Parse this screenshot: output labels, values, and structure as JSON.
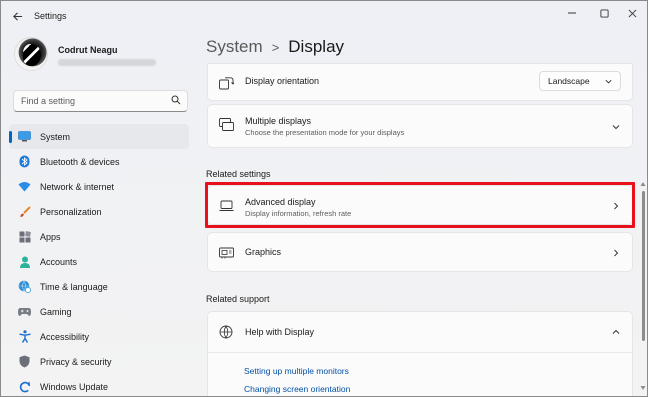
{
  "window": {
    "title": "Settings",
    "back_icon": "back-arrow-icon",
    "controls": [
      "minimize-icon",
      "maximize-icon",
      "close-icon"
    ]
  },
  "profile": {
    "name": "Codrut Neagu"
  },
  "search": {
    "placeholder": "Find a setting"
  },
  "sidebar": {
    "items": [
      {
        "label": "System",
        "icon": "system-icon",
        "active": true
      },
      {
        "label": "Bluetooth & devices",
        "icon": "bluetooth-icon"
      },
      {
        "label": "Network & internet",
        "icon": "wifi-icon"
      },
      {
        "label": "Personalization",
        "icon": "brush-icon"
      },
      {
        "label": "Apps",
        "icon": "apps-icon"
      },
      {
        "label": "Accounts",
        "icon": "person-icon"
      },
      {
        "label": "Time & language",
        "icon": "globe-clock-icon"
      },
      {
        "label": "Gaming",
        "icon": "gamepad-icon"
      },
      {
        "label": "Accessibility",
        "icon": "accessibility-icon"
      },
      {
        "label": "Privacy & security",
        "icon": "shield-icon"
      },
      {
        "label": "Windows Update",
        "icon": "update-icon"
      }
    ]
  },
  "breadcrumb": {
    "parent": "System",
    "separator": ">",
    "current": "Display"
  },
  "main": {
    "display_orientation": {
      "title": "Display orientation",
      "value": "Landscape"
    },
    "multiple_displays": {
      "title": "Multiple displays",
      "subtitle": "Choose the presentation mode for your displays"
    },
    "related_settings_label": "Related settings",
    "advanced_display": {
      "title": "Advanced display",
      "subtitle": "Display information, refresh rate"
    },
    "graphics": {
      "title": "Graphics"
    },
    "related_support_label": "Related support",
    "help": {
      "title": "Help with Display",
      "links": [
        "Setting up multiple monitors",
        "Changing screen orientation"
      ]
    }
  },
  "colors": {
    "accent": "#0067c0",
    "highlight": "#e8111b",
    "link": "#0050a8"
  }
}
